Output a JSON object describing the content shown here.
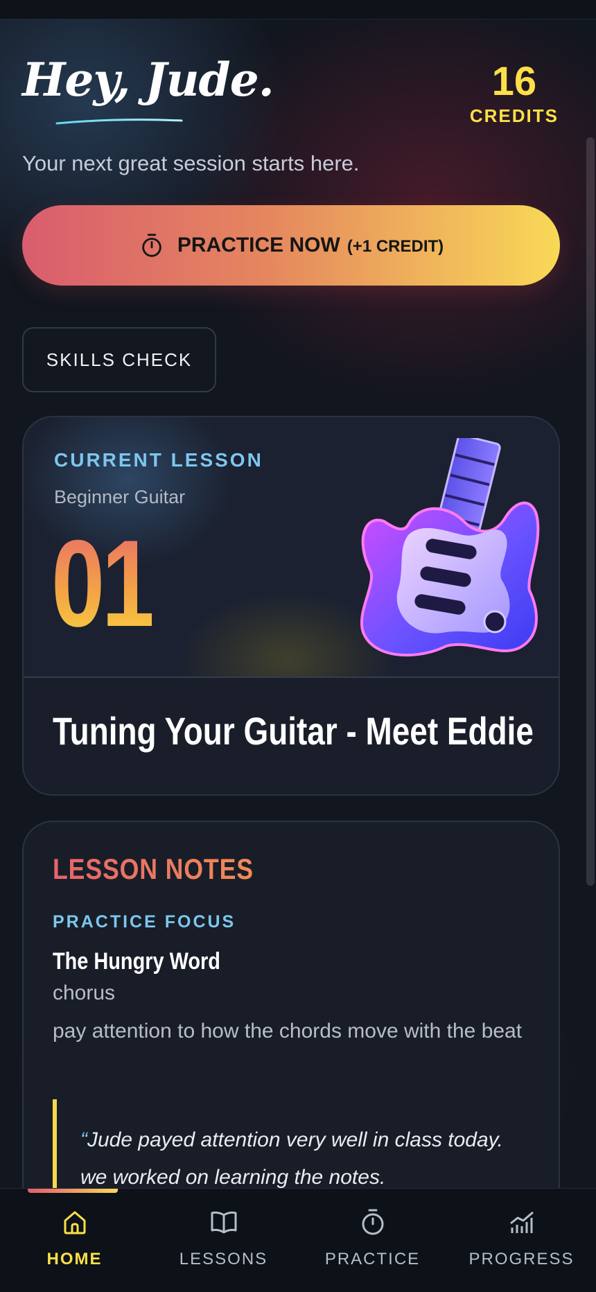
{
  "header": {
    "greeting": "Hey, Jude.",
    "tagline": "Your next great session starts here.",
    "credits_count": "16",
    "credits_label": "CREDITS"
  },
  "actions": {
    "practice_label": "PRACTICE NOW",
    "practice_sub": "(+1 CREDIT)",
    "skills_label": "SKILLS CHECK"
  },
  "current_lesson": {
    "label": "CURRENT LESSON",
    "course": "Beginner Guitar",
    "number": "01",
    "title": "Tuning Your Guitar - Meet Eddie"
  },
  "lesson_notes": {
    "title": "LESSON NOTES",
    "focus_label": "PRACTICE FOCUS",
    "song": "The Hungry Word",
    "section": "chorus",
    "focus_text": "pay attention to how the chords move with the beat",
    "quote": "Jude payed attention very well in class today. we worked on learning the notes."
  },
  "nav": {
    "items": [
      {
        "label": "HOME",
        "icon": "home-icon",
        "active": true
      },
      {
        "label": "LESSONS",
        "icon": "book-icon",
        "active": false
      },
      {
        "label": "PRACTICE",
        "icon": "stopwatch-icon",
        "active": false
      },
      {
        "label": "PROGRESS",
        "icon": "chart-icon",
        "active": false
      }
    ]
  },
  "colors": {
    "accent_yellow": "#fde047",
    "accent_blue": "#7cc7ef",
    "accent_red": "#e6636c",
    "background": "#12161f"
  }
}
